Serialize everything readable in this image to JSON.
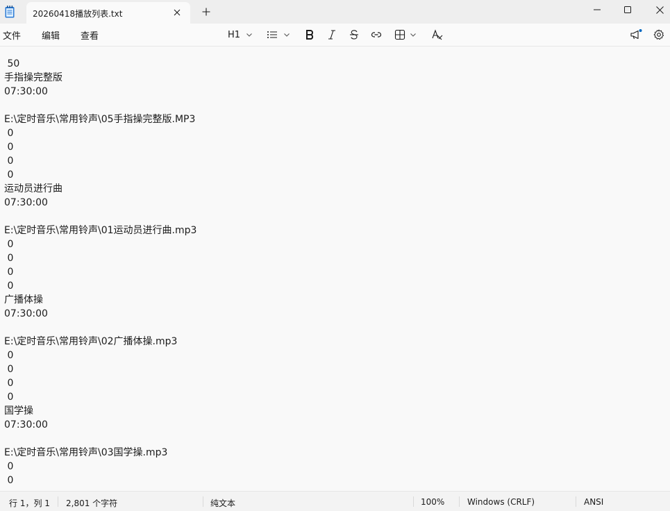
{
  "tab": {
    "title": "20260418播放列表.txt"
  },
  "menu": {
    "file": "文件",
    "edit": "编辑",
    "view": "查看"
  },
  "toolbar": {
    "heading": "H1"
  },
  "editor": {
    "lines": [
      " 50",
      "手指操完整版",
      "07:30:00",
      "",
      "E:\\定时音乐\\常用铃声\\05手指操完整版.MP3",
      " 0",
      " 0",
      " 0",
      " 0",
      "运动员进行曲",
      "07:30:00",
      "",
      "E:\\定时音乐\\常用铃声\\01运动员进行曲.mp3",
      " 0",
      " 0",
      " 0",
      " 0",
      "广播体操",
      "07:30:00",
      "",
      "E:\\定时音乐\\常用铃声\\02广播体操.mp3",
      " 0",
      " 0",
      " 0",
      " 0",
      "国学操",
      "07:30:00",
      "",
      "E:\\定时音乐\\常用铃声\\03国学操.mp3",
      " 0",
      " 0"
    ]
  },
  "status": {
    "position": "行 1，列 1",
    "char_count": "2,801 个字符",
    "format": "纯文本",
    "zoom": "100%",
    "line_ending": "Windows (CRLF)",
    "encoding": "ANSI"
  }
}
